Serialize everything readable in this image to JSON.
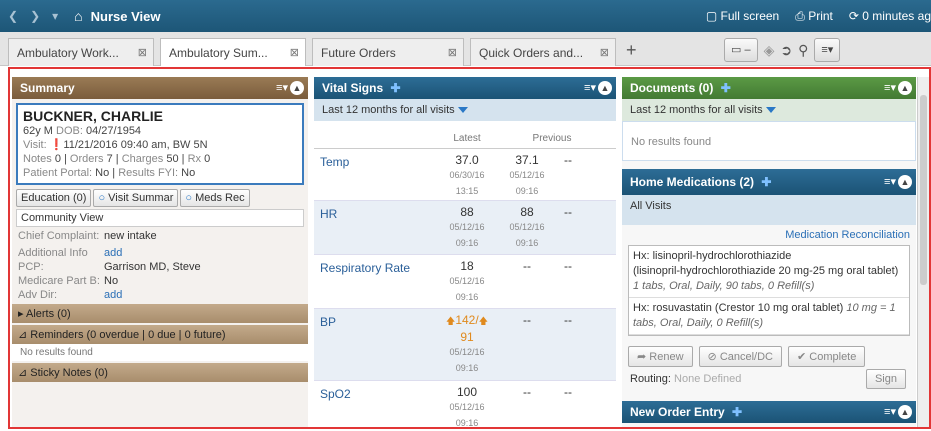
{
  "window": {
    "title": "Nurse View",
    "full_screen": "Full screen",
    "print": "Print",
    "refresh": "0 minutes ag"
  },
  "tabs": [
    {
      "label": "Ambulatory Work..."
    },
    {
      "label": "Ambulatory Sum..."
    },
    {
      "label": "Future Orders"
    },
    {
      "label": "Quick Orders and..."
    }
  ],
  "summary": {
    "title": "Summary",
    "patient_name": "BUCKNER, CHARLIE",
    "age_sex": "62y M",
    "dob_label": "DOB:",
    "dob": "04/27/1954",
    "visit_label": "Visit:",
    "visit": "11/21/2016 09:40 am,",
    "visit_loc": "BW 5N",
    "notes_label": "Notes",
    "notes": "0",
    "orders_label": "Orders",
    "orders": "7",
    "charges_label": "Charges",
    "charges": "50",
    "rx_label": "Rx",
    "rx": "0",
    "portal_label": "Patient Portal:",
    "portal": "No",
    "results_label": "Results FYI:",
    "results": "No",
    "education": "Education (0)",
    "visit_summary": "Visit Summar",
    "meds_rec": "Meds Rec",
    "community": "Community View",
    "chief_label": "Chief Complaint:",
    "chief": "new intake",
    "addl_label": "Additional Info",
    "addl": "add",
    "pcp_label": "PCP:",
    "pcp": "Garrison MD, Steve",
    "medicare_label": "Medicare Part B:",
    "medicare": "No",
    "adv_label": "Adv Dir:",
    "adv": "add",
    "alerts": "Alerts (0)",
    "reminders": "Reminders (0 overdue | 0 due | 0 future)",
    "no_results": "No results found",
    "sticky": "Sticky Notes (0)"
  },
  "vitals": {
    "title": "Vital Signs",
    "filter": "Last 12 months for all visits",
    "col_latest": "Latest",
    "col_previous": "Previous",
    "rows": [
      {
        "name": "Temp",
        "latest": "37.0",
        "ld": "06/30/16",
        "lt": "13:15",
        "prev": "37.1",
        "pd": "05/12/16",
        "pt": "09:16",
        "extra": "--"
      },
      {
        "name": "HR",
        "latest": "88",
        "ld": "05/12/16",
        "lt": "09:16",
        "prev": "88",
        "pd": "05/12/16",
        "pt": "09:16",
        "extra": "--"
      },
      {
        "name": "Respiratory Rate",
        "latest": "18",
        "ld": "05/12/16",
        "lt": "09:16",
        "prev": "--",
        "pd": "",
        "pt": "",
        "extra": "--"
      },
      {
        "name": "BP",
        "latest": "142",
        "latest2": "91",
        "ld": "05/12/16",
        "lt": "09:16",
        "prev": "--",
        "pd": "",
        "pt": "",
        "extra": "--"
      },
      {
        "name": "SpO2",
        "latest": "100",
        "ld": "05/12/16",
        "lt": "09:16",
        "prev": "--",
        "pd": "",
        "pt": "",
        "extra": "--"
      }
    ]
  },
  "documents": {
    "title": "Documents (0)",
    "filter": "Last 12 months for all visits",
    "empty": "No results found"
  },
  "home_meds": {
    "title": "Home Medications (2)",
    "filter": "All Visits",
    "reconcile": "Medication Reconciliation",
    "items": [
      {
        "hx": "Hx:",
        "name": "lisinopril-hydrochlorothiazide",
        "detail": "(lisinopril-hydrochlorothiazide 20 mg-25 mg oral tablet)",
        "sig": "1 tabs, Oral, Daily, 90 tabs, 0 Refill(s)"
      },
      {
        "hx": "Hx:",
        "name": "rosuvastatin (Crestor 10 mg oral tablet)",
        "detail": "",
        "sig": "10 mg = 1 tabs, Oral, Daily, 0 Refill(s)"
      }
    ],
    "renew": "Renew",
    "cancel": "Cancel/DC",
    "complete": "Complete",
    "routing_label": "Routing:",
    "routing": "None Defined",
    "sign": "Sign"
  },
  "new_order": {
    "title": "New Order Entry"
  },
  "colors": {
    "brown": "#8a6b48",
    "blue": "#225f86",
    "green": "#4f8a3b",
    "accent": "#e23636"
  }
}
